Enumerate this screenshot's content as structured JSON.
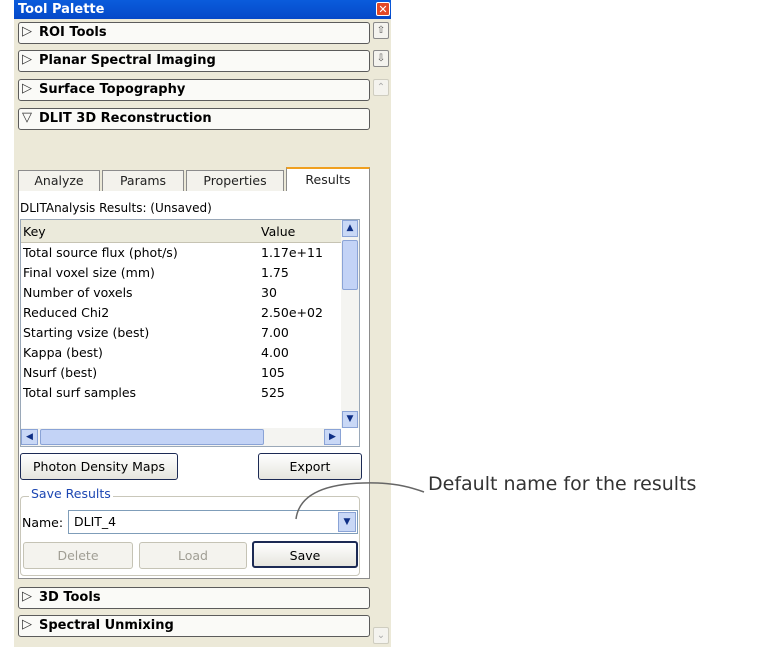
{
  "window": {
    "title": "Tool Palette",
    "close_glyph": "✕"
  },
  "sections": {
    "roi": {
      "arrow": "▷",
      "label": "ROI Tools"
    },
    "planar": {
      "arrow": "▷",
      "label": "Planar Spectral Imaging"
    },
    "surface": {
      "arrow": "▷",
      "label": "Surface Topography"
    },
    "dlit": {
      "arrow": "▽",
      "label": "DLIT 3D Reconstruction"
    },
    "tools3d": {
      "arrow": "▷",
      "label": "3D Tools"
    },
    "spectral": {
      "arrow": "▷",
      "label": "Spectral Unmixing"
    }
  },
  "tabs": [
    {
      "label": "Analyze"
    },
    {
      "label": "Params"
    },
    {
      "label": "Properties"
    },
    {
      "label": "Results"
    }
  ],
  "results": {
    "title": "DLITAnalysis Results: (Unsaved)",
    "columns": {
      "key": "Key",
      "value": "Value"
    },
    "rows": [
      {
        "key": "Total source flux (phot/s)",
        "value": "1.17e+11"
      },
      {
        "key": "Final voxel size (mm)",
        "value": "1.75"
      },
      {
        "key": "Number of voxels",
        "value": "30"
      },
      {
        "key": "Reduced Chi2",
        "value": "2.50e+02"
      },
      {
        "key": "Starting vsize (best)",
        "value": "7.00"
      },
      {
        "key": "Kappa (best)",
        "value": "4.00"
      },
      {
        "key": "Nsurf (best)",
        "value": "105"
      },
      {
        "key": "Total surf samples",
        "value": "525"
      }
    ]
  },
  "buttons": {
    "photon_density": "Photon Density Maps",
    "export": "Export",
    "delete": "Delete",
    "load": "Load",
    "save": "Save"
  },
  "save_results": {
    "group_label": "Save Results",
    "name_label": "Name:",
    "name_value": "DLIT_4"
  },
  "callout": {
    "text": "Default name for the results"
  },
  "icons": {
    "close": "close-icon",
    "scroll_up": "scroll-up-icon",
    "scroll_down": "scroll-down-icon",
    "dropdown": "chevron-down-icon"
  }
}
